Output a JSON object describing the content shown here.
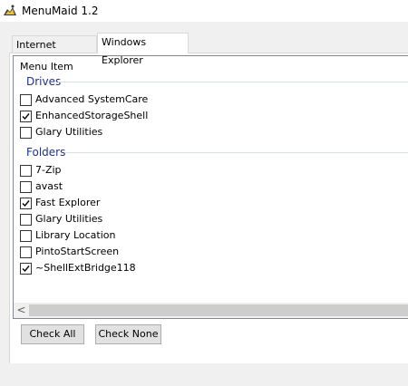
{
  "window": {
    "title": "MenuMaid 1.2",
    "icon": "menumaid-app-icon"
  },
  "tabs": [
    {
      "label": "Internet Explorer",
      "selected": false
    },
    {
      "label": "Windows Explorer",
      "selected": true
    }
  ],
  "list": {
    "column_header": "Menu Item",
    "groups": [
      {
        "name": "Drives",
        "items": [
          {
            "label": "Advanced SystemCare",
            "checked": false
          },
          {
            "label": "EnhancedStorageShell",
            "checked": true
          },
          {
            "label": "Glary Utilities",
            "checked": false
          }
        ]
      },
      {
        "name": "Folders",
        "items": [
          {
            "label": "7-Zip",
            "checked": false
          },
          {
            "label": "avast",
            "checked": false
          },
          {
            "label": "Fast Explorer",
            "checked": true
          },
          {
            "label": "Glary Utilities",
            "checked": false
          },
          {
            "label": "Library Location",
            "checked": false
          },
          {
            "label": "PintoStartScreen",
            "checked": false
          },
          {
            "label": "~ShellExtBridge118",
            "checked": true
          }
        ]
      }
    ]
  },
  "scrollbar": {
    "left_arrow": "<"
  },
  "buttons": {
    "check_all": "Check All",
    "check_none": "Check None"
  },
  "colors": {
    "group_header": "#1e3287",
    "panel_bg": "#ffffff",
    "window_bg": "#f0f0f0"
  }
}
